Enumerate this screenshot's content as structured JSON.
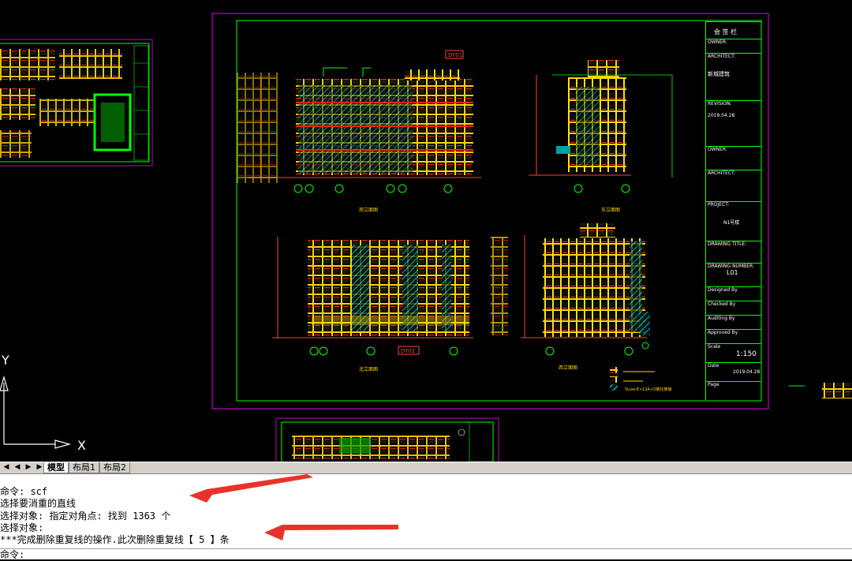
{
  "model_space": {
    "ucs_y_label": "Y",
    "ucs_x_label": "X"
  },
  "title_block": {
    "header": "会 签 栏",
    "owner_label": "OWNER:",
    "architect_label": "ARCHITECT:",
    "company_name": "新城建筑",
    "revision_label": "REVISION:",
    "revision_date": "2019.04.28",
    "owner_label_2": "OWNER:",
    "architect_label_2": "ARCHITECT:",
    "project_label": "PROJECT:",
    "project_name": "N1号楼",
    "drawing_title_label": "DRAWING TITLE:",
    "drawing_number_label": "DRAWING NUMBER:",
    "drawing_number": "L01",
    "designed_by": "Designed By",
    "checked_by": "Checked By",
    "auditing_by": "Auditing By",
    "approved_by": "Approved By",
    "scale_label": "Scale",
    "scale_value": "1:150",
    "date_label": "Date",
    "date_value": "2019.04.28",
    "page_label": "Page"
  },
  "drawing": {
    "elev_tag_1": "DY01",
    "elev_tag_2": "DY02",
    "view_title_a": "南立面图",
    "view_title_b": "东立面图",
    "view_title_c": "北立面图",
    "view_title_d": "西立面图",
    "legend_text": "5Low-E+12A+5钢化玻璃"
  },
  "tabs": {
    "model": "模型",
    "layout1": "布局1",
    "layout2": "布局2"
  },
  "command_lines": [
    "命令: scf",
    "选择要消重的直线",
    "选择对象: 指定对角点: 找到 1363 个",
    "选择对象:",
    "***完成删除重复线的操作.此次删除重复线【 5 】条",
    "命令:"
  ],
  "colors": {
    "canvas_bg": "#000000",
    "frame_magenta": "#c000c0",
    "frame_green": "#00ff00",
    "annotation_red": "#ff0000",
    "hatch_yellow": "#ffff00",
    "glass_cyan": "#00ffff",
    "arrow_red": "#e8332a"
  }
}
